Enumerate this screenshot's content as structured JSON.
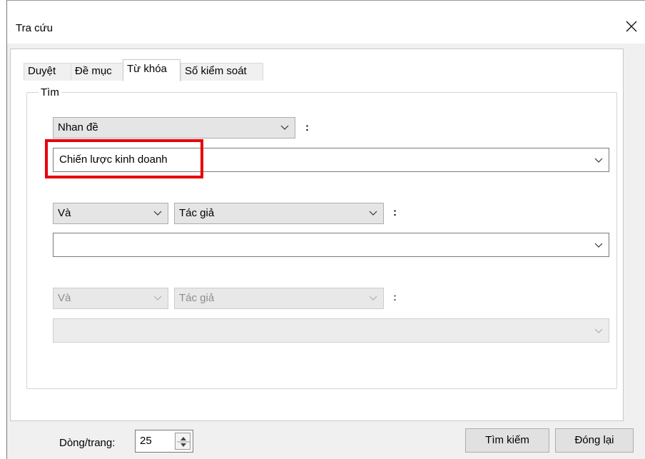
{
  "window": {
    "title": "Tra cứu",
    "close_icon": "close-icon"
  },
  "tabs": [
    {
      "label": "Duyệt",
      "active": false
    },
    {
      "label": "Đề mục",
      "active": false
    },
    {
      "label": "Từ khóa",
      "active": true
    },
    {
      "label": "Số kiểm soát",
      "active": false
    }
  ],
  "search": {
    "group_label": "Tìm",
    "colon": ":",
    "row1": {
      "field": "Nhan đề",
      "value": "Chiến lược kinh doanh"
    },
    "row2": {
      "operator": "Và",
      "field": "Tác giả",
      "value": ""
    },
    "row3": {
      "operator": "Và",
      "field": "Tác giả",
      "value": "",
      "disabled": true
    }
  },
  "footer": {
    "rows_label": "Dòng/trang:",
    "rows_value": "25",
    "search_button": "Tìm kiếm",
    "close_button": "Đóng lại"
  },
  "colors": {
    "highlight": "#e8000b"
  }
}
